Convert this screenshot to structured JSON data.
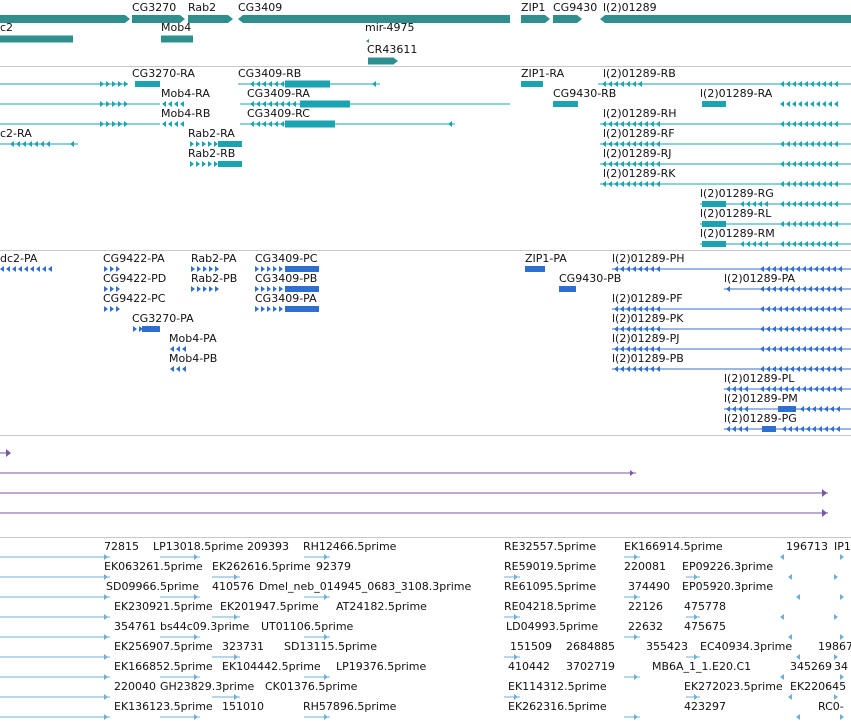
{
  "colors": {
    "gene": "#2f8f8f",
    "transcript": "#1aa3b0",
    "protein": "#2f6fd0",
    "rna": "#7a55a8",
    "est": "#6fb0d8",
    "separator": "#c8c8c8"
  },
  "tracks": {
    "genes": [
      {
        "label": "CG3270"
      },
      {
        "label": "Rab2"
      },
      {
        "label": "CG3409"
      },
      {
        "label": "ZIP1"
      },
      {
        "label": "CG9430"
      },
      {
        "label": "l(2)01289"
      },
      {
        "label": "c2"
      },
      {
        "label": "Mob4"
      },
      {
        "label": "mir-4975"
      },
      {
        "label": "CR43611"
      }
    ],
    "transcripts": [
      {
        "label": "CG3270-RA"
      },
      {
        "label": "CG3409-RB"
      },
      {
        "label": "ZIP1-RA"
      },
      {
        "label": "l(2)01289-RB"
      },
      {
        "label": "Mob4-RA"
      },
      {
        "label": "CG3409-RA"
      },
      {
        "label": "CG9430-RB"
      },
      {
        "label": "l(2)01289-RA"
      },
      {
        "label": "Mob4-RB"
      },
      {
        "label": "CG3409-RC"
      },
      {
        "label": "l(2)01289-RH"
      },
      {
        "label": "c2-RA"
      },
      {
        "label": "Rab2-RA"
      },
      {
        "label": "l(2)01289-RF"
      },
      {
        "label": "Rab2-RB"
      },
      {
        "label": "l(2)01289-RJ"
      },
      {
        "label": "l(2)01289-RK"
      },
      {
        "label": "l(2)01289-RG"
      },
      {
        "label": "l(2)01289-RL"
      },
      {
        "label": "l(2)01289-RM"
      }
    ],
    "proteins": [
      {
        "label": "dc2-PA"
      },
      {
        "label": "CG9422-PA"
      },
      {
        "label": "Rab2-PA"
      },
      {
        "label": "CG3409-PC"
      },
      {
        "label": "ZIP1-PA"
      },
      {
        "label": "l(2)01289-PH"
      },
      {
        "label": "CG9422-PD"
      },
      {
        "label": "Rab2-PB"
      },
      {
        "label": "CG3409-PB"
      },
      {
        "label": "CG9430-PB"
      },
      {
        "label": "l(2)01289-PA"
      },
      {
        "label": "CG9422-PC"
      },
      {
        "label": "CG3409-PA"
      },
      {
        "label": "l(2)01289-PF"
      },
      {
        "label": "CG3270-PA"
      },
      {
        "label": "l(2)01289-PK"
      },
      {
        "label": "Mob4-PA"
      },
      {
        "label": "l(2)01289-PJ"
      },
      {
        "label": "Mob4-PB"
      },
      {
        "label": "l(2)01289-PB"
      },
      {
        "label": "l(2)01289-PL"
      },
      {
        "label": "l(2)01289-PM"
      },
      {
        "label": "l(2)01289-PG"
      }
    ],
    "ests": [
      {
        "label": "72815"
      },
      {
        "label": "LP13018.5prime"
      },
      {
        "label": "209393"
      },
      {
        "label": "RH12466.5prime"
      },
      {
        "label": "RE32557.5prime"
      },
      {
        "label": "EK166914.5prime"
      },
      {
        "label": "196713"
      },
      {
        "label": "IP1"
      },
      {
        "label": "EK063261.5prime"
      },
      {
        "label": "EK262616.5prime"
      },
      {
        "label": "92379"
      },
      {
        "label": "RE59019.5prime"
      },
      {
        "label": "220081"
      },
      {
        "label": "EP09226.3prime"
      },
      {
        "label": "SD09966.5prime"
      },
      {
        "label": "410576"
      },
      {
        "label": "Dmel_neb_014945_0683_3108.3prime"
      },
      {
        "label": "RE61095.5prime"
      },
      {
        "label": "374490"
      },
      {
        "label": "EP05920.3prime"
      },
      {
        "label": "EK230921.5prime"
      },
      {
        "label": "EK201947.5prime"
      },
      {
        "label": "AT24182.5prime"
      },
      {
        "label": "RE04218.5prime"
      },
      {
        "label": "22126"
      },
      {
        "label": "475778"
      },
      {
        "label": "354761"
      },
      {
        "label": "bs44c09.3prime"
      },
      {
        "label": "UT01106.5prime"
      },
      {
        "label": "LD04993.5prime"
      },
      {
        "label": "22632"
      },
      {
        "label": "475675"
      },
      {
        "label": "EK256907.5prime"
      },
      {
        "label": "323731"
      },
      {
        "label": "SD13115.5prime"
      },
      {
        "label": "151509"
      },
      {
        "label": "2684885"
      },
      {
        "label": "355423"
      },
      {
        "label": "EC40934.3prime"
      },
      {
        "label": "19867"
      },
      {
        "label": "EK166852.5prime"
      },
      {
        "label": "EK104442.5prime"
      },
      {
        "label": "LP19376.5prime"
      },
      {
        "label": "410442"
      },
      {
        "label": "3702719"
      },
      {
        "label": "MB6A_1_1.E20.C1"
      },
      {
        "label": "345269"
      },
      {
        "label": "34"
      },
      {
        "label": "220040"
      },
      {
        "label": "GH23829.3prime"
      },
      {
        "label": "CK01376.5prime"
      },
      {
        "label": "EK114312.5prime"
      },
      {
        "label": "EK272023.5prime"
      },
      {
        "label": "EK220645"
      },
      {
        "label": "EK136123.5prime"
      },
      {
        "label": "151010"
      },
      {
        "label": "RH57896.5prime"
      },
      {
        "label": "EK262316.5prime"
      },
      {
        "label": "423297"
      },
      {
        "label": "RC0-"
      }
    ]
  }
}
